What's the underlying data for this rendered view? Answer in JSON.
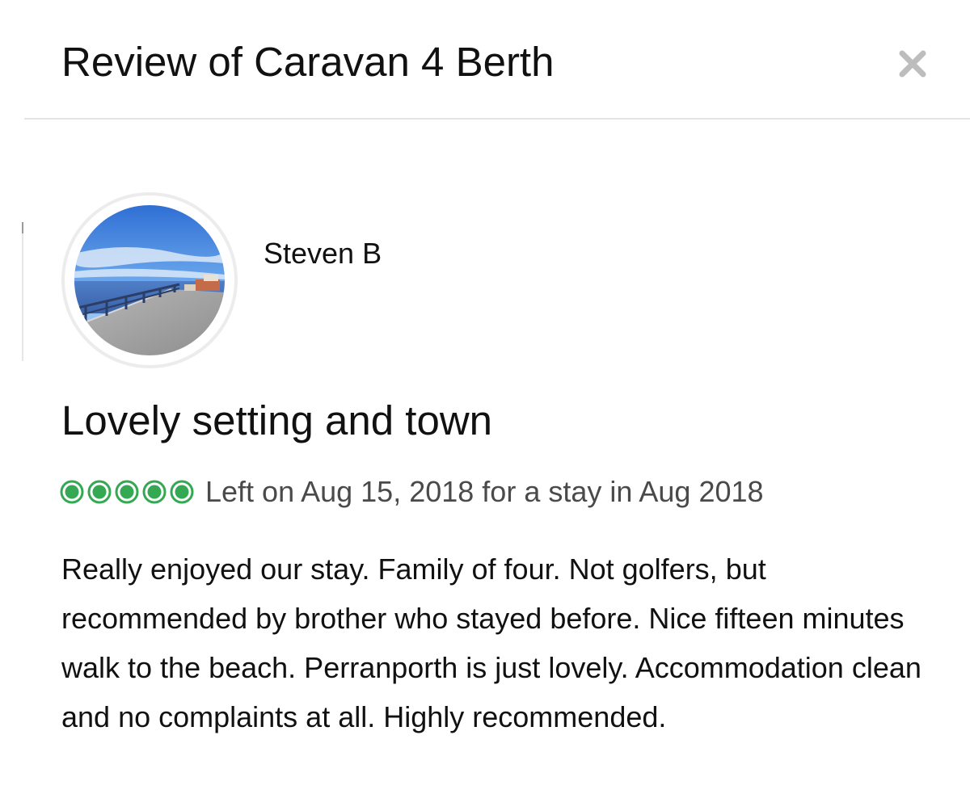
{
  "modal": {
    "title": "Review of Caravan 4 Berth",
    "close_icon": "close-icon"
  },
  "reviewer": {
    "name": "Steven B",
    "avatar_icon": "avatar-photo"
  },
  "review": {
    "title": "Lovely setting and town",
    "rating": 5,
    "rating_max": 5,
    "rating_color": "#34a853",
    "meta": "Left on Aug 15, 2018 for a stay in Aug 2018",
    "body": "Really enjoyed our stay. Family of four. Not golfers, but recommended by brother who stayed before. Nice fifteen minutes walk to the beach. Perranporth is just lovely. Accommodation clean and no complaints at all. Highly recommended."
  },
  "colors": {
    "rating_green": "#34a853",
    "divider": "#e3e3e3",
    "close_gray": "#bdbdbd"
  }
}
